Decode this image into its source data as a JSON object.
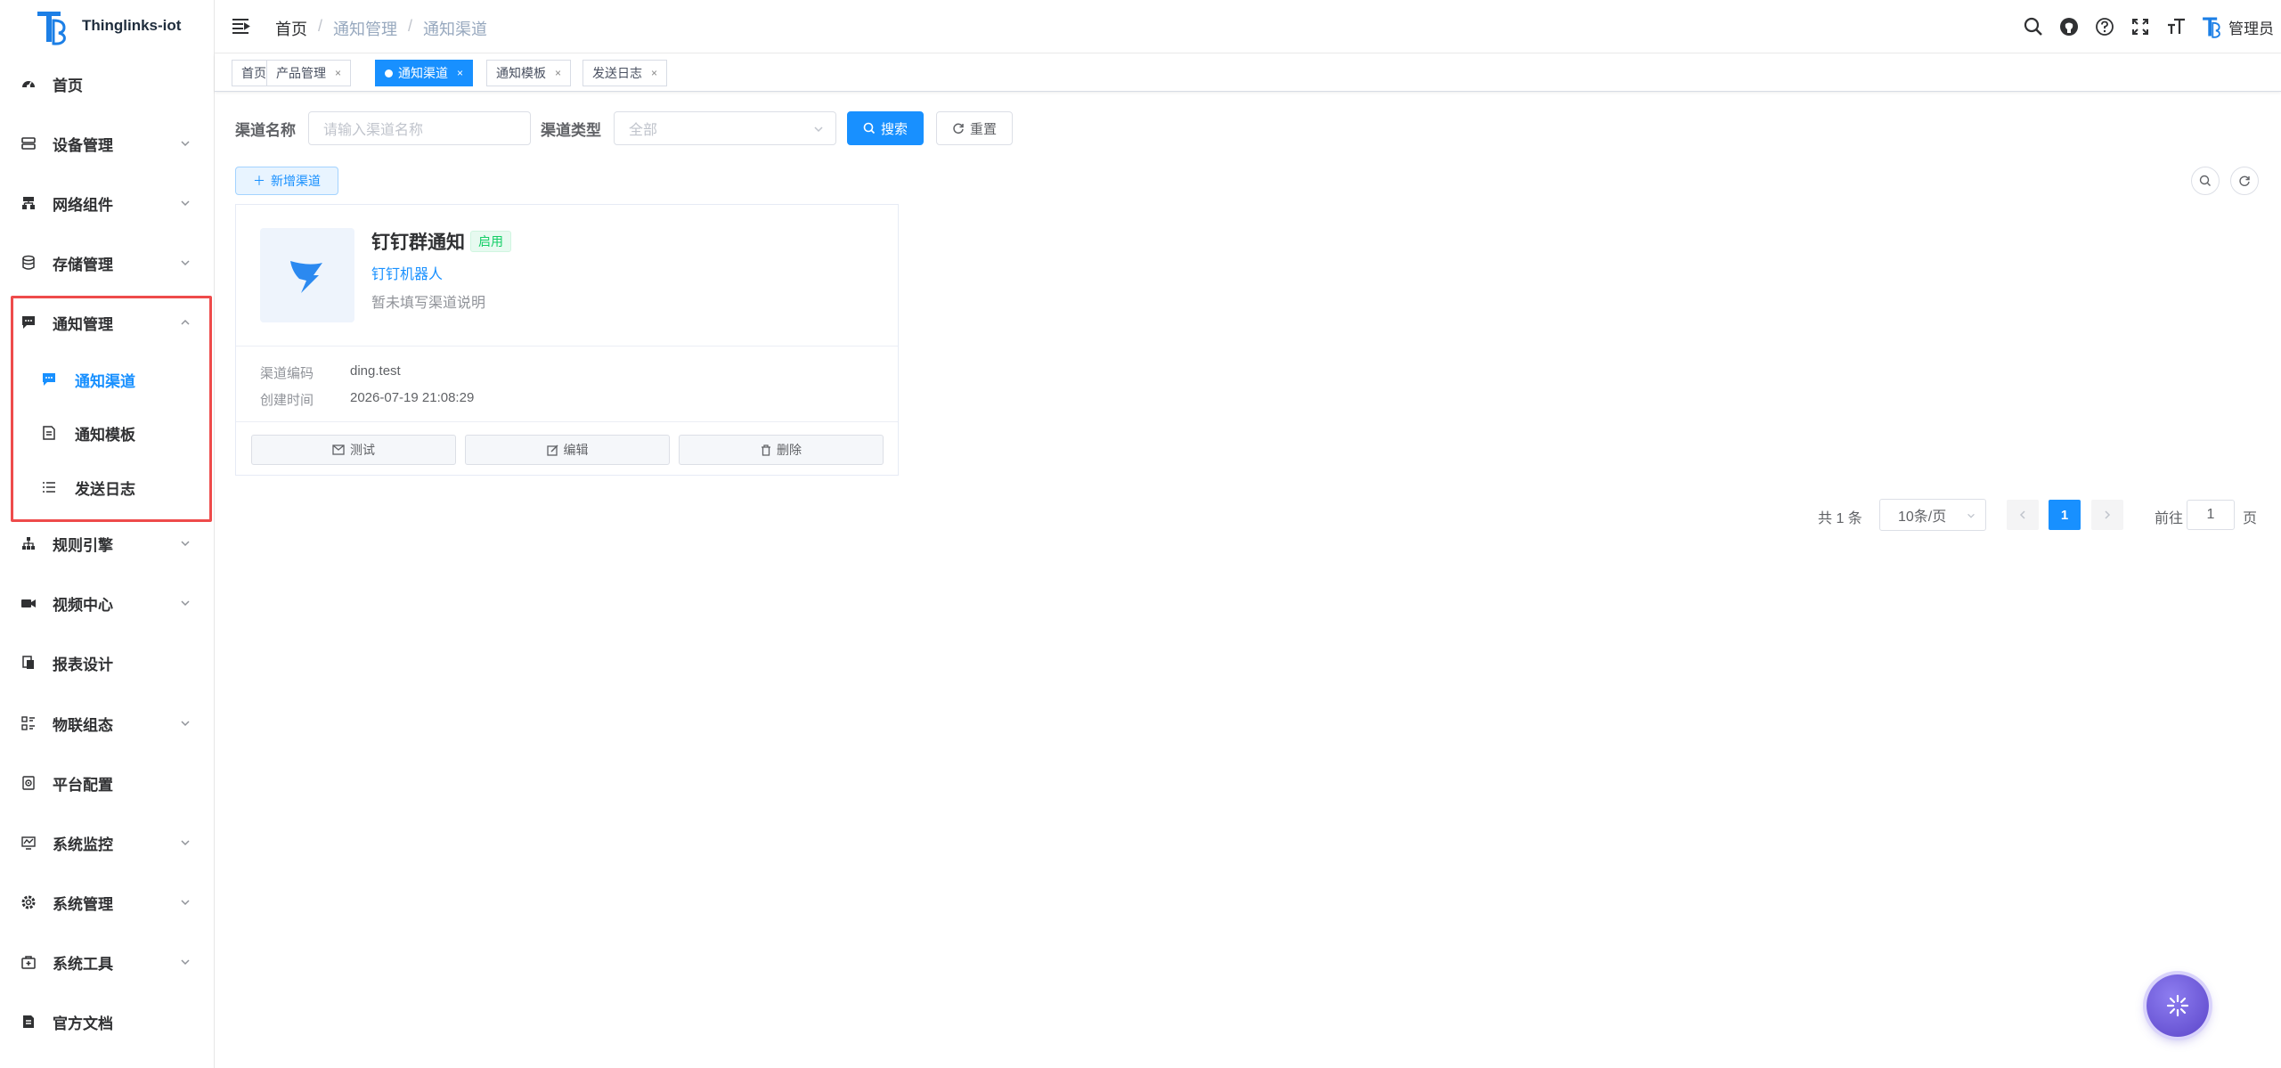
{
  "app": {
    "name": "Thinglinks-iot"
  },
  "sidebar": {
    "items": [
      {
        "label": "首页",
        "icon": "dashboard-icon",
        "expandable": false
      },
      {
        "label": "设备管理",
        "icon": "device-icon",
        "expandable": true
      },
      {
        "label": "网络组件",
        "icon": "network-icon",
        "expandable": true
      },
      {
        "label": "存储管理",
        "icon": "database-icon",
        "expandable": true
      },
      {
        "label": "通知管理",
        "icon": "message-icon",
        "expandable": true,
        "expanded": true
      },
      {
        "label": "规则引擎",
        "icon": "tree-icon",
        "expandable": true
      },
      {
        "label": "视频中心",
        "icon": "video-icon",
        "expandable": true
      },
      {
        "label": "报表设计",
        "icon": "report-icon",
        "expandable": false
      },
      {
        "label": "物联组态",
        "icon": "config-icon",
        "expandable": true
      },
      {
        "label": "平台配置",
        "icon": "platform-icon",
        "expandable": false
      },
      {
        "label": "系统监控",
        "icon": "monitor-icon",
        "expandable": true
      },
      {
        "label": "系统管理",
        "icon": "gear-icon",
        "expandable": true
      },
      {
        "label": "系统工具",
        "icon": "toolbox-icon",
        "expandable": true
      },
      {
        "label": "官方文档",
        "icon": "document-icon",
        "expandable": false
      }
    ],
    "sub_items": [
      {
        "label": "通知渠道",
        "icon": "message-icon",
        "active": true
      },
      {
        "label": "通知模板",
        "icon": "template-icon",
        "active": false
      },
      {
        "label": "发送日志",
        "icon": "list-icon",
        "active": false
      }
    ]
  },
  "header": {
    "breadcrumb": [
      "首页",
      "通知管理",
      "通知渠道"
    ],
    "user": "管理员"
  },
  "tags": [
    {
      "label": "首页",
      "closable": false,
      "active": false
    },
    {
      "label": "产品管理",
      "closable": true,
      "active": false
    },
    {
      "label": "通知渠道",
      "closable": true,
      "active": true
    },
    {
      "label": "通知模板",
      "closable": true,
      "active": false
    },
    {
      "label": "发送日志",
      "closable": true,
      "active": false
    }
  ],
  "search": {
    "name_label": "渠道名称",
    "name_placeholder": "请输入渠道名称",
    "type_label": "渠道类型",
    "type_value": "全部",
    "search_button": "搜索",
    "reset_button": "重置"
  },
  "toolbar": {
    "add_button": "新增渠道"
  },
  "card": {
    "title": "钉钉群通知",
    "status": "启用",
    "type": "钉钉机器人",
    "description": "暂未填写渠道说明",
    "fields": [
      {
        "key": "渠道编码",
        "value": "ding.test"
      },
      {
        "key": "创建时间",
        "value": "2026-07-19 21:08:29"
      }
    ],
    "actions": [
      "测试",
      "编辑",
      "删除"
    ]
  },
  "pagination": {
    "total": "共 1 条",
    "page_size": "10条/页",
    "current": "1",
    "goto_label": "前往",
    "goto_value": "1",
    "page_suffix": "页"
  },
  "colors": {
    "primary": "#1890ff",
    "success": "#13ce66",
    "highlight": "#ee4b4b"
  }
}
